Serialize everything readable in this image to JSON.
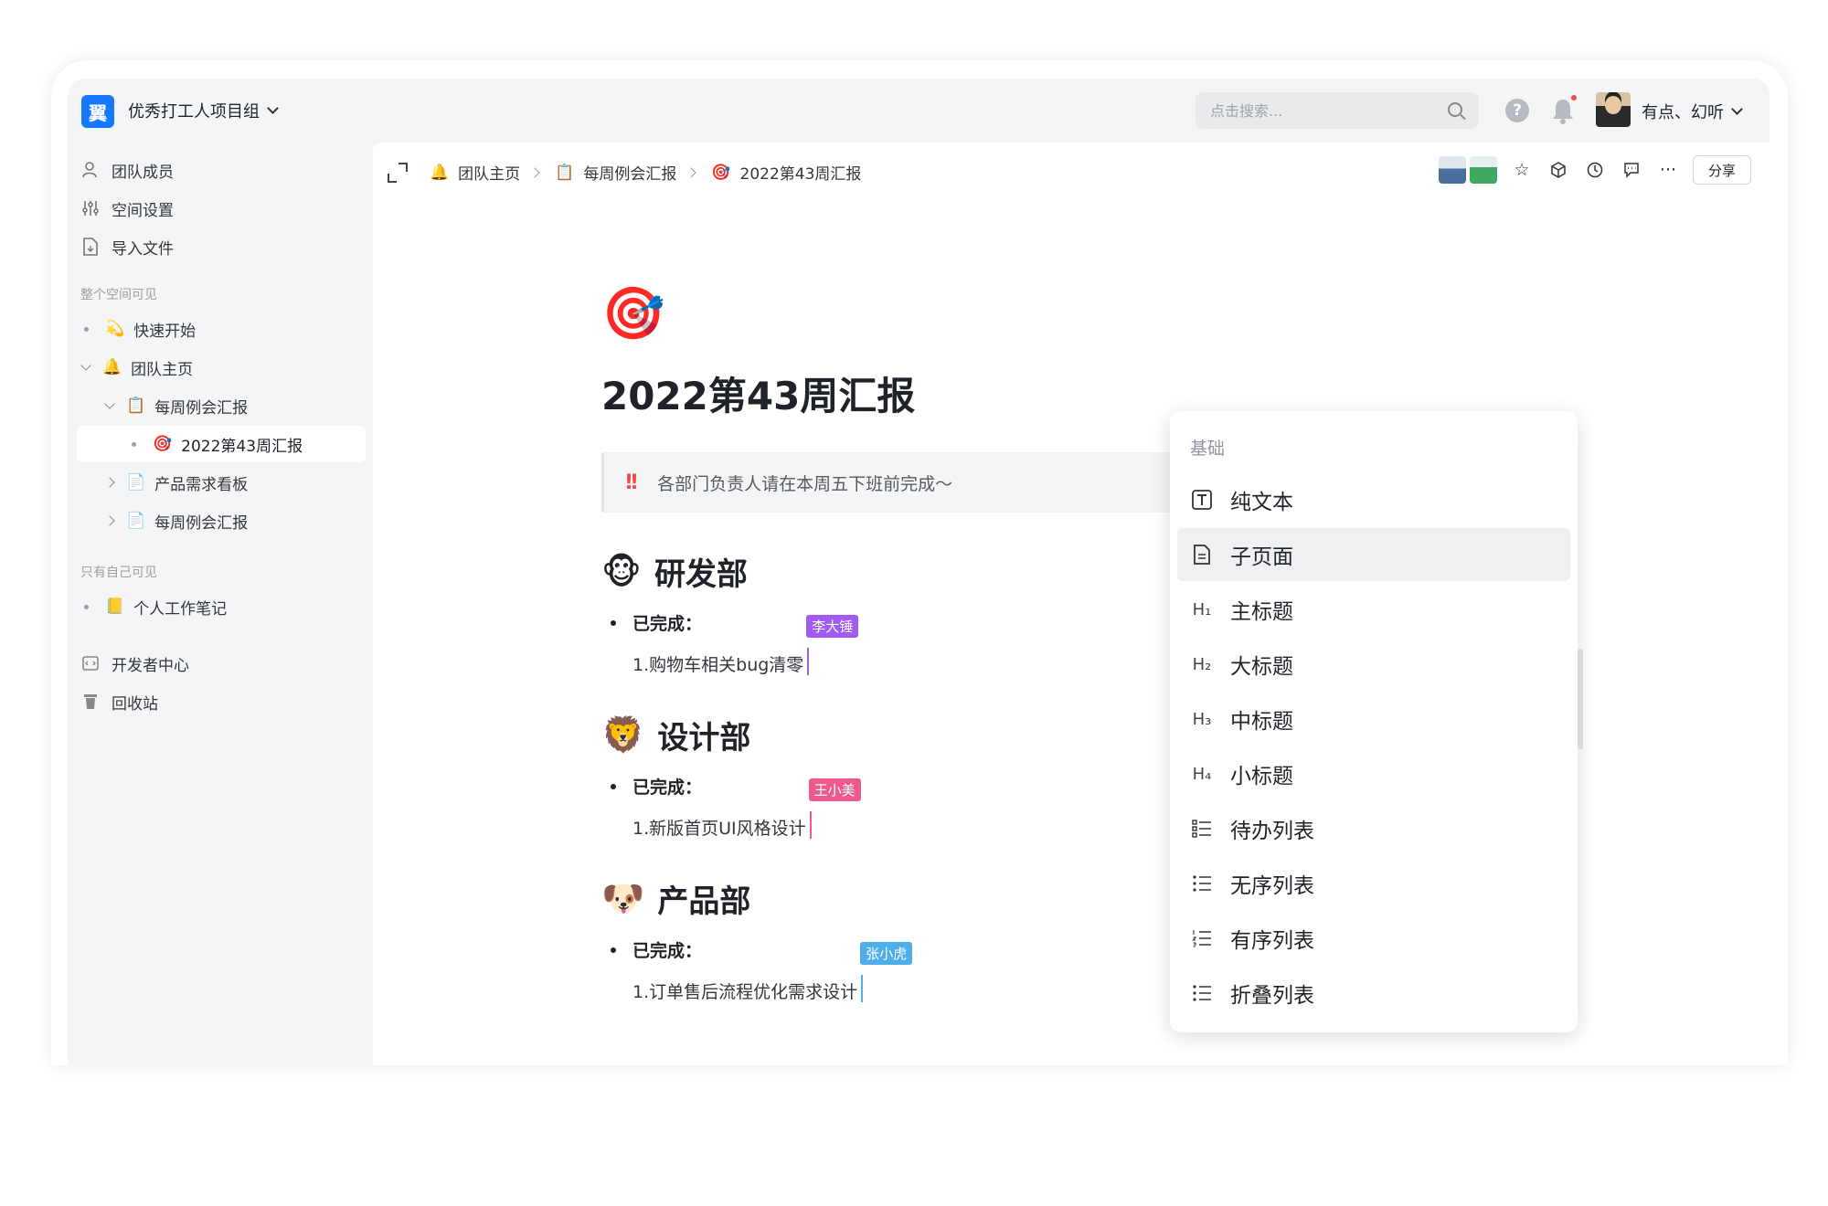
{
  "header": {
    "logo_char": "翼",
    "workspace_name": "优秀打工人项目组",
    "search_placeholder": "点击搜索...",
    "help_char": "?",
    "user_name": "有点、幻听"
  },
  "sidebar": {
    "top_items": [
      {
        "label": "团队成员",
        "icon": "users-icon"
      },
      {
        "label": "空间设置",
        "icon": "sliders-icon"
      },
      {
        "label": "导入文件",
        "icon": "import-file-icon"
      }
    ],
    "section_public": "整个空间可见",
    "tree": [
      {
        "label": "快速开始",
        "emoji": "💫"
      },
      {
        "label": "团队主页",
        "emoji": "🔔"
      },
      {
        "label": "每周例会汇报",
        "emoji": "📋"
      },
      {
        "label": "2022第43周汇报",
        "emoji": "🎯"
      },
      {
        "label": "产品需求看板",
        "emoji": "📄"
      },
      {
        "label": "每周例会汇报",
        "emoji": "📄"
      }
    ],
    "section_private": "只有自己可见",
    "private_items": [
      {
        "label": "个人工作笔记",
        "emoji": "📒"
      }
    ],
    "bottom_items": [
      {
        "label": "开发者中心",
        "icon": "code-icon"
      },
      {
        "label": "回收站",
        "icon": "trash-icon"
      }
    ]
  },
  "breadcrumb": [
    {
      "label": "团队主页",
      "emoji": "🔔"
    },
    {
      "label": "每周例会汇报",
      "emoji": "📋"
    },
    {
      "label": "2022第43周汇报",
      "emoji": "🎯"
    }
  ],
  "toolbar": {
    "more_char": "···",
    "share_label": "分享"
  },
  "document": {
    "emoji": "🎯",
    "title": "2022第43周汇报",
    "callout_icon": "!!",
    "callout_text": "各部门负责人请在本周五下班前完成～",
    "sections": [
      {
        "emoji": "🐵",
        "heading": "研发部",
        "bullet": "已完成：",
        "task": "1.购物车相关bug清零",
        "cursor_user": "李大锤",
        "cursor_color": "#a25bf0"
      },
      {
        "emoji": "🦁",
        "heading": "设计部",
        "bullet": "已完成：",
        "task": "1.新版首页UI风格设计",
        "cursor_user": "王小美",
        "cursor_color": "#ef5a8c"
      },
      {
        "emoji": "🐶",
        "heading": "产品部",
        "bullet": "已完成：",
        "task": "1.订单售后流程优化需求设计",
        "cursor_user": "张小虎",
        "cursor_color": "#4daeea"
      }
    ]
  },
  "menu": {
    "heading": "基础",
    "items": [
      {
        "label": "纯文本",
        "icon": "text-T-icon",
        "glyph": "T"
      },
      {
        "label": "子页面",
        "icon": "page-icon",
        "glyph": "▤"
      },
      {
        "label": "主标题",
        "icon": "h1-icon",
        "glyph": "H₁"
      },
      {
        "label": "大标题",
        "icon": "h2-icon",
        "glyph": "H₂"
      },
      {
        "label": "中标题",
        "icon": "h3-icon",
        "glyph": "H₃"
      },
      {
        "label": "小标题",
        "icon": "h4-icon",
        "glyph": "H₄"
      },
      {
        "label": "待办列表",
        "icon": "todo-list-icon",
        "glyph": "☷"
      },
      {
        "label": "无序列表",
        "icon": "bullet-list-icon",
        "glyph": "☰"
      },
      {
        "label": "有序列表",
        "icon": "ordered-list-icon",
        "glyph": "☰"
      },
      {
        "label": "折叠列表",
        "icon": "toggle-list-icon",
        "glyph": "☰"
      }
    ],
    "hovered_index": 1
  }
}
